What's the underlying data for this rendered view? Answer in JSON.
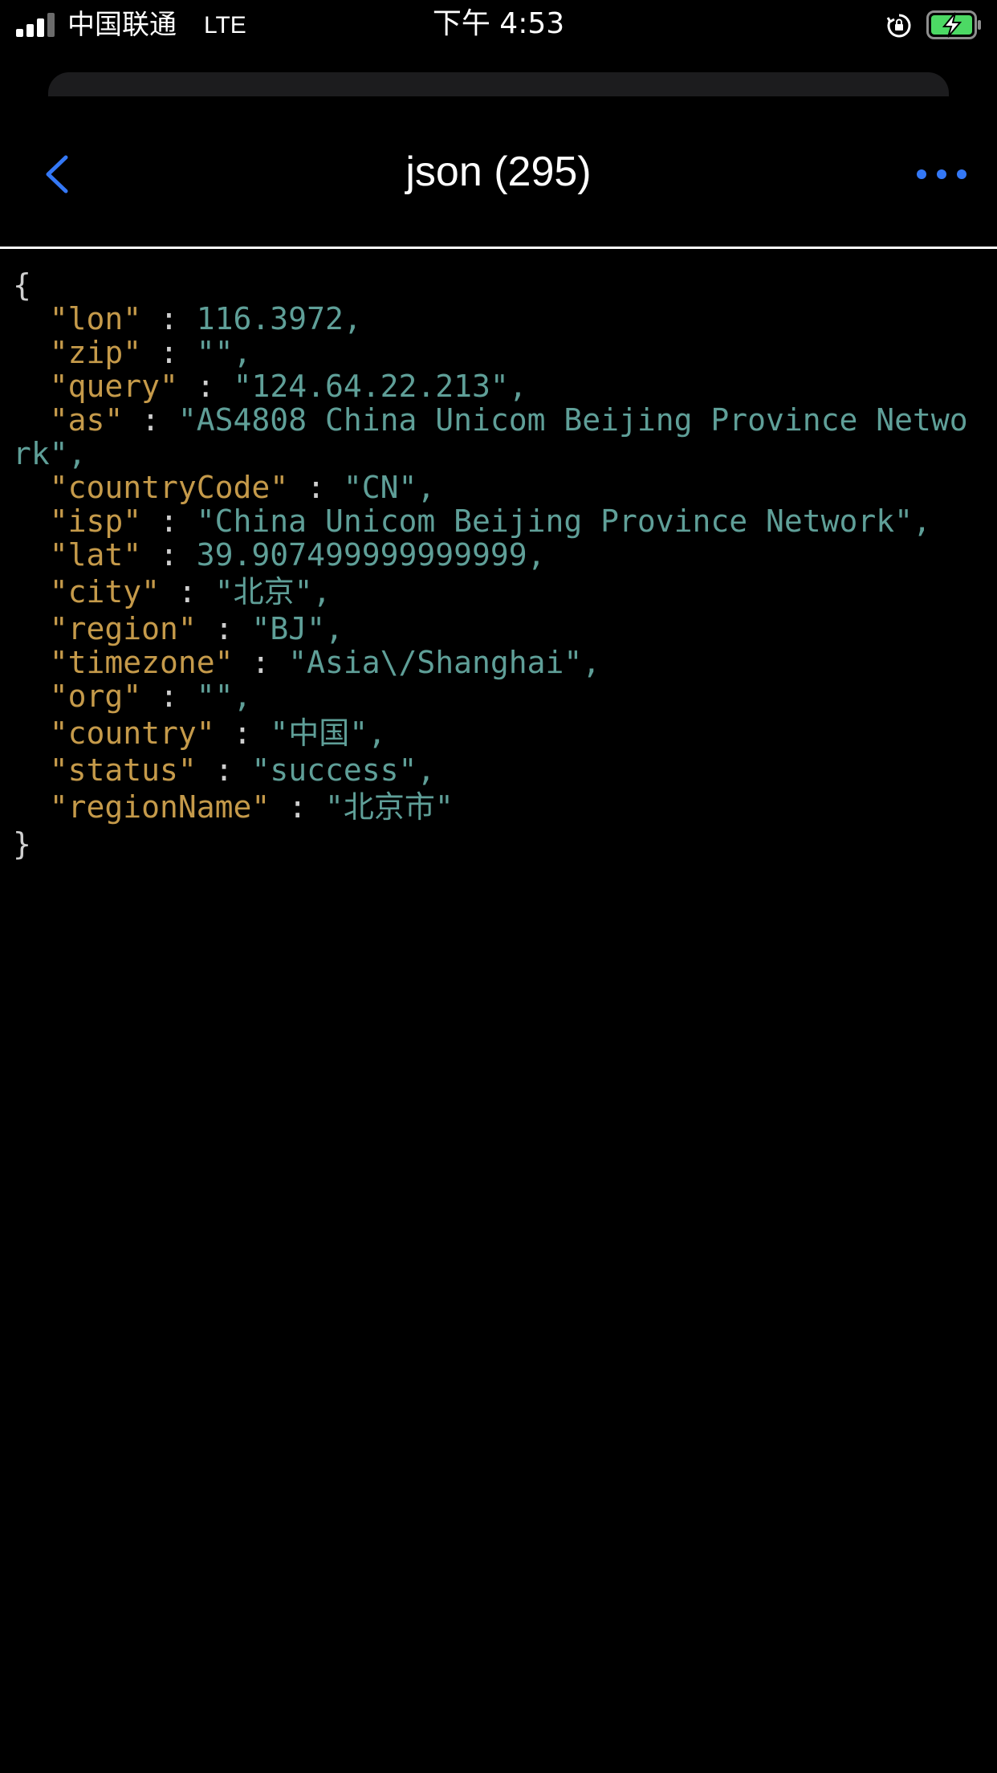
{
  "status_bar": {
    "carrier": "中国联通",
    "network": "LTE",
    "time": "下午 4:53",
    "signal_bars": 3,
    "icons": {
      "signal": "signal-strength-icon",
      "rotation_lock": "rotation-lock-icon",
      "battery": "battery-charging-icon"
    },
    "battery_color": "#4cd964"
  },
  "nav": {
    "title": "json (295)",
    "back_icon": "chevron-left-icon",
    "more_icon": "ellipsis-icon",
    "accent_color": "#3478f6"
  },
  "json": {
    "open_brace": "{",
    "close_brace": "}",
    "entries": [
      {
        "key": "\"lon\"",
        "value": "116.3972,"
      },
      {
        "key": "\"zip\"",
        "value": "\"\","
      },
      {
        "key": "\"query\"",
        "value": "\"124.64.22.213\","
      },
      {
        "key": "\"as\"",
        "value": "\"AS4808 China Unicom Beijing Province Network\","
      },
      {
        "key": "\"countryCode\"",
        "value": "\"CN\","
      },
      {
        "key": "\"isp\"",
        "value": "\"China Unicom Beijing Province Network\","
      },
      {
        "key": "\"lat\"",
        "value": "39.907499999999999,"
      },
      {
        "key": "\"city\"",
        "value": "\"北京\","
      },
      {
        "key": "\"region\"",
        "value": "\"BJ\","
      },
      {
        "key": "\"timezone\"",
        "value": "\"Asia\\/Shanghai\","
      },
      {
        "key": "\"org\"",
        "value": "\"\","
      },
      {
        "key": "\"country\"",
        "value": "\"中国\","
      },
      {
        "key": "\"status\"",
        "value": "\"success\","
      },
      {
        "key": "\"regionName\"",
        "value": "\"北京市\""
      }
    ],
    "colors": {
      "key": "#c59a4a",
      "value": "#5f9f98",
      "punctuation": "#cfcfcf"
    }
  }
}
